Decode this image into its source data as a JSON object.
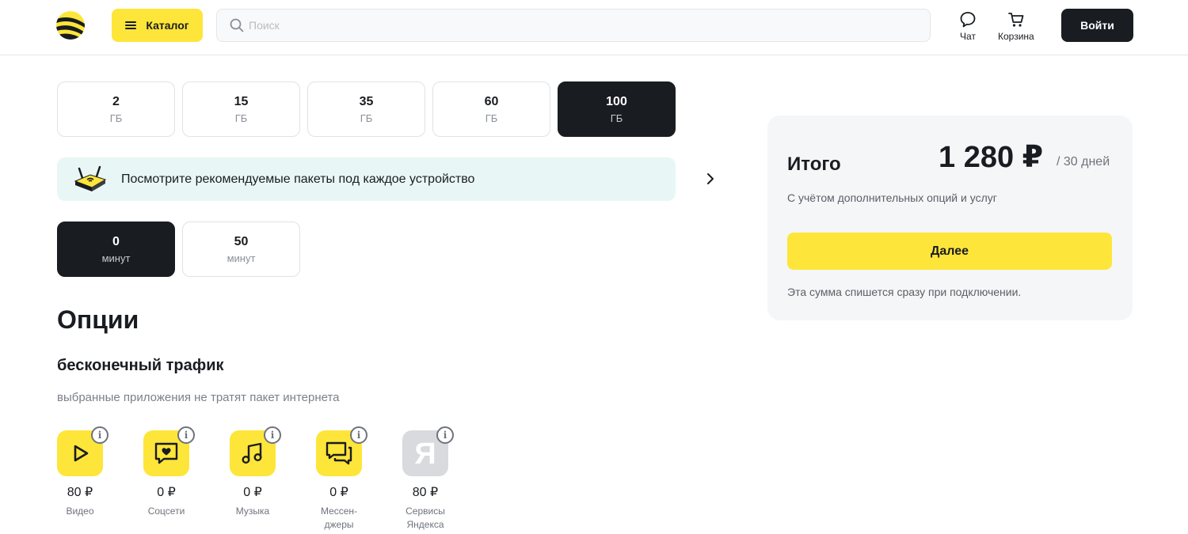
{
  "header": {
    "logo_icon": "beeline-logo-icon",
    "catalog_label": "Каталог",
    "search_placeholder": "Поиск",
    "chat_label": "Чат",
    "cart_label": "Корзина",
    "login_label": "Войти"
  },
  "data_packages": [
    {
      "value": "2",
      "unit": "ГБ",
      "selected": false
    },
    {
      "value": "15",
      "unit": "ГБ",
      "selected": false
    },
    {
      "value": "35",
      "unit": "ГБ",
      "selected": false
    },
    {
      "value": "60",
      "unit": "ГБ",
      "selected": false
    },
    {
      "value": "100",
      "unit": "ГБ",
      "selected": true
    }
  ],
  "banner": {
    "text": "Посмотрите рекомендуемые пакеты под каждое устройство"
  },
  "minute_packages": [
    {
      "value": "0",
      "unit": "минут",
      "selected": true
    },
    {
      "value": "50",
      "unit": "минут",
      "selected": false
    }
  ],
  "options": {
    "title": "Опции",
    "traffic_title": "бесконечный трафик",
    "traffic_subtitle": "выбранные приложения не тратят пакет интернета",
    "apps": [
      {
        "icon": "play-icon",
        "price": "80 ₽",
        "name": "Видео"
      },
      {
        "icon": "social-heart-icon",
        "price": "0 ₽",
        "name": "Соцсети"
      },
      {
        "icon": "music-note-icon",
        "price": "0 ₽",
        "name": "Музыка"
      },
      {
        "icon": "messenger-icon",
        "price": "0 ₽",
        "name": "Мессен-\nджеры"
      },
      {
        "icon": "yandex-icon",
        "price": "80 ₽",
        "name": "Сервисы\nЯндекса"
      }
    ]
  },
  "total": {
    "label": "Итого",
    "price": "1 280 ₽",
    "period": "/ 30 дней",
    "note": "С учётом дополнительных опций и услуг",
    "next_label": "Далее",
    "charge_note": "Эта сумма спишется сразу при подключении."
  },
  "colors": {
    "accent": "#fee53a",
    "dark": "#191c21",
    "banner_bg": "#e8f7f5",
    "card_bg": "#f5f6f7"
  }
}
